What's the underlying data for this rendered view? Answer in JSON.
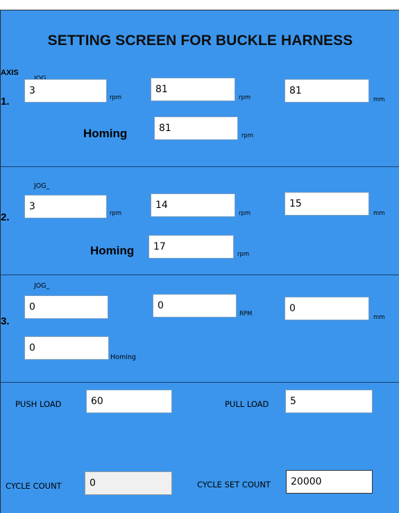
{
  "title": "SETTING SCREEN FOR BUCKLE HARNESS",
  "axis_label": "AXIS",
  "axes": [
    {
      "number": "1.",
      "jog_label": "JOG_",
      "jog_value": "3",
      "jog_unit": "rpm",
      "speed_value": "81",
      "speed_unit": "rpm",
      "distance_value": "81",
      "distance_unit": "mm",
      "homing_label": "Homing",
      "homing_value": "81",
      "homing_unit": "rpm"
    },
    {
      "number": "2.",
      "jog_label": "JOG_",
      "jog_value": "3",
      "jog_unit": "rpm",
      "speed_value": "14",
      "speed_unit": "rpm",
      "distance_value": "15",
      "distance_unit": "mm",
      "homing_label": "Homing",
      "homing_value": "17",
      "homing_unit": "rpm"
    },
    {
      "number": "3.",
      "jog_label": "JOG_",
      "jog_value": "0",
      "speed_value": "0",
      "speed_unit": "RPM",
      "distance_value": "0",
      "distance_unit": "mm",
      "homing_value": "0",
      "homing_label": "Homing"
    }
  ],
  "loads": {
    "push_label": "PUSH LOAD",
    "push_value": "60",
    "pull_label": "PULL  LOAD",
    "pull_value": "5"
  },
  "cycle": {
    "count_label": "CYCLE COUNT",
    "count_value": "0",
    "set_label": "CYCLE SET COUNT",
    "set_value": "20000"
  },
  "colors": {
    "background": "#3b95ec",
    "field": "#ffffff",
    "readonly_field": "#f0f0f0",
    "separator": "#1a3a6b"
  }
}
